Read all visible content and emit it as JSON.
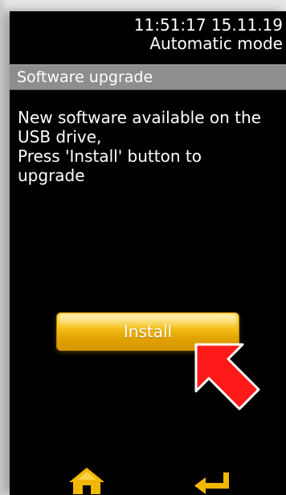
{
  "status": {
    "clock": "11:51:17  15.11.19",
    "mode": "Automatic mode"
  },
  "title": "Software upgrade",
  "message_lines": [
    "New software available on the",
    "USB drive,",
    "Press 'Install' button to",
    "upgrade"
  ],
  "install_button": {
    "label": "Install",
    "color": "#f0b400"
  },
  "annotation": {
    "arrow_color": "#ff1a1a"
  },
  "nav": {
    "home_icon": "home-icon",
    "enter_icon": "enter-icon",
    "icon_color": "#f2b800"
  },
  "colors": {
    "screen_bg": "#000000",
    "title_bar_bg": "#8e8e8e",
    "text": "#ffffff"
  }
}
